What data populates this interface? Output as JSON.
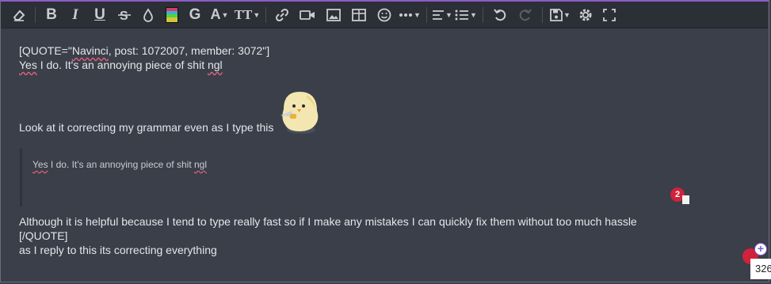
{
  "toolbar": {
    "buttons": [
      {
        "name": "remove-format-icon"
      },
      {
        "name": "bold-icon",
        "label": "B"
      },
      {
        "name": "italic-icon",
        "label": "I"
      },
      {
        "name": "underline-icon",
        "label": "U"
      },
      {
        "name": "strikethrough-icon"
      },
      {
        "name": "text-color-icon"
      },
      {
        "name": "gif-icon"
      },
      {
        "name": "google-icon",
        "label": "G"
      },
      {
        "name": "font-family-icon",
        "label": "A"
      },
      {
        "name": "font-size-icon",
        "label": "TT"
      },
      {
        "name": "link-icon"
      },
      {
        "name": "video-icon"
      },
      {
        "name": "image-icon"
      },
      {
        "name": "table-icon"
      },
      {
        "name": "emoji-icon"
      },
      {
        "name": "more-icon"
      },
      {
        "name": "align-icon"
      },
      {
        "name": "list-icon"
      },
      {
        "name": "undo-icon"
      },
      {
        "name": "redo-icon"
      },
      {
        "name": "drafts-icon"
      },
      {
        "name": "settings-icon"
      },
      {
        "name": "fullscreen-icon"
      }
    ]
  },
  "editor": {
    "quote_open_prefix": "[QUOTE=\"",
    "quote_author": "Navinci",
    "quote_open_suffix": ", post: 1072007, member: 3072\"]",
    "reply_yes": "Yes",
    "reply_mid": " I do. It's an annoying piece of shit ",
    "reply_ngl": "ngl",
    "look_line": "Look at it correcting my grammar even as I type this",
    "nested_yes": "Yes",
    "nested_mid": " I do. It's an annoying piece of shit ",
    "nested_ngl": "ngl",
    "helpful_line": "Although it is helpful because I tend to type really fast so if I make any mistakes I can quickly fix them without too much hassle",
    "quote_close": "[/QUOTE]",
    "reply_line": "as I reply to this its correcting everything"
  },
  "grammar": {
    "badge_count": "2",
    "word_counter": "326"
  },
  "colors": {
    "accent": "#8a5cc7",
    "spell_underline": "#e0607e",
    "badge": "#d0223a"
  }
}
